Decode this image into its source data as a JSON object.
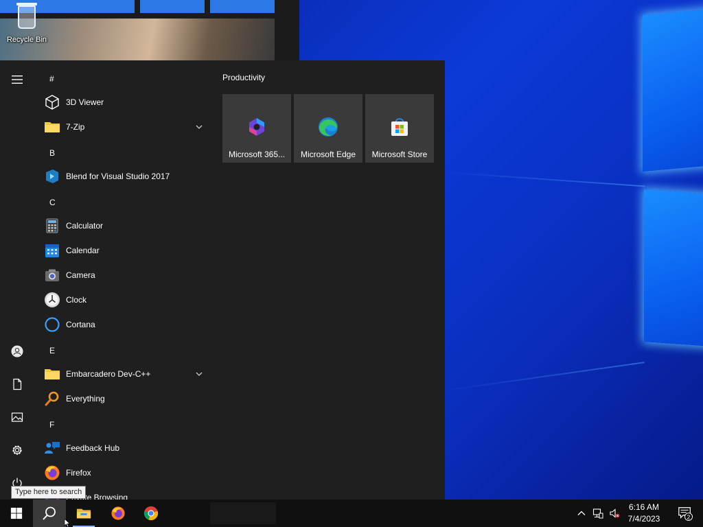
{
  "desktop": {
    "recycle_bin_label": "Recycle Bin"
  },
  "start_menu": {
    "app_list": [
      {
        "type": "header",
        "label": "#"
      },
      {
        "type": "app",
        "label": "3D Viewer",
        "icon": "cube-icon"
      },
      {
        "type": "app",
        "label": "7-Zip",
        "icon": "folder-icon",
        "expandable": true
      },
      {
        "type": "header",
        "label": "B"
      },
      {
        "type": "app",
        "label": "Blend for Visual Studio 2017",
        "icon": "blend-icon"
      },
      {
        "type": "header",
        "label": "C"
      },
      {
        "type": "app",
        "label": "Calculator",
        "icon": "calculator-icon"
      },
      {
        "type": "app",
        "label": "Calendar",
        "icon": "calendar-icon"
      },
      {
        "type": "app",
        "label": "Camera",
        "icon": "camera-icon"
      },
      {
        "type": "app",
        "label": "Clock",
        "icon": "clock-icon"
      },
      {
        "type": "app",
        "label": "Cortana",
        "icon": "cortana-icon"
      },
      {
        "type": "header",
        "label": "E"
      },
      {
        "type": "app",
        "label": "Embarcadero Dev-C++",
        "icon": "folder-icon",
        "expandable": true
      },
      {
        "type": "app",
        "label": "Everything",
        "icon": "magnifier-icon"
      },
      {
        "type": "header",
        "label": "F"
      },
      {
        "type": "app",
        "label": "Feedback Hub",
        "icon": "feedback-icon"
      },
      {
        "type": "app",
        "label": "Firefox",
        "icon": "firefox-icon"
      },
      {
        "type": "app",
        "label": "Private Browsing",
        "icon": "private-browsing-icon"
      }
    ],
    "tile_group": {
      "label": "Productivity",
      "tiles": [
        {
          "label": "Microsoft 365...",
          "icon": "m365-icon"
        },
        {
          "label": "Microsoft Edge",
          "icon": "edge-icon"
        },
        {
          "label": "Microsoft Store",
          "icon": "store-icon"
        }
      ]
    }
  },
  "tooltip": "Type here to search",
  "taskbar": {
    "clock": {
      "time": "6:16 AM",
      "date": "7/4/2023"
    },
    "notification_count": "2"
  },
  "colors": {
    "menu_bg": "#1f1f1f",
    "tile_bg": "#3a3a3a",
    "taskbar_bg": "#101010",
    "accent": "#0078d4"
  }
}
